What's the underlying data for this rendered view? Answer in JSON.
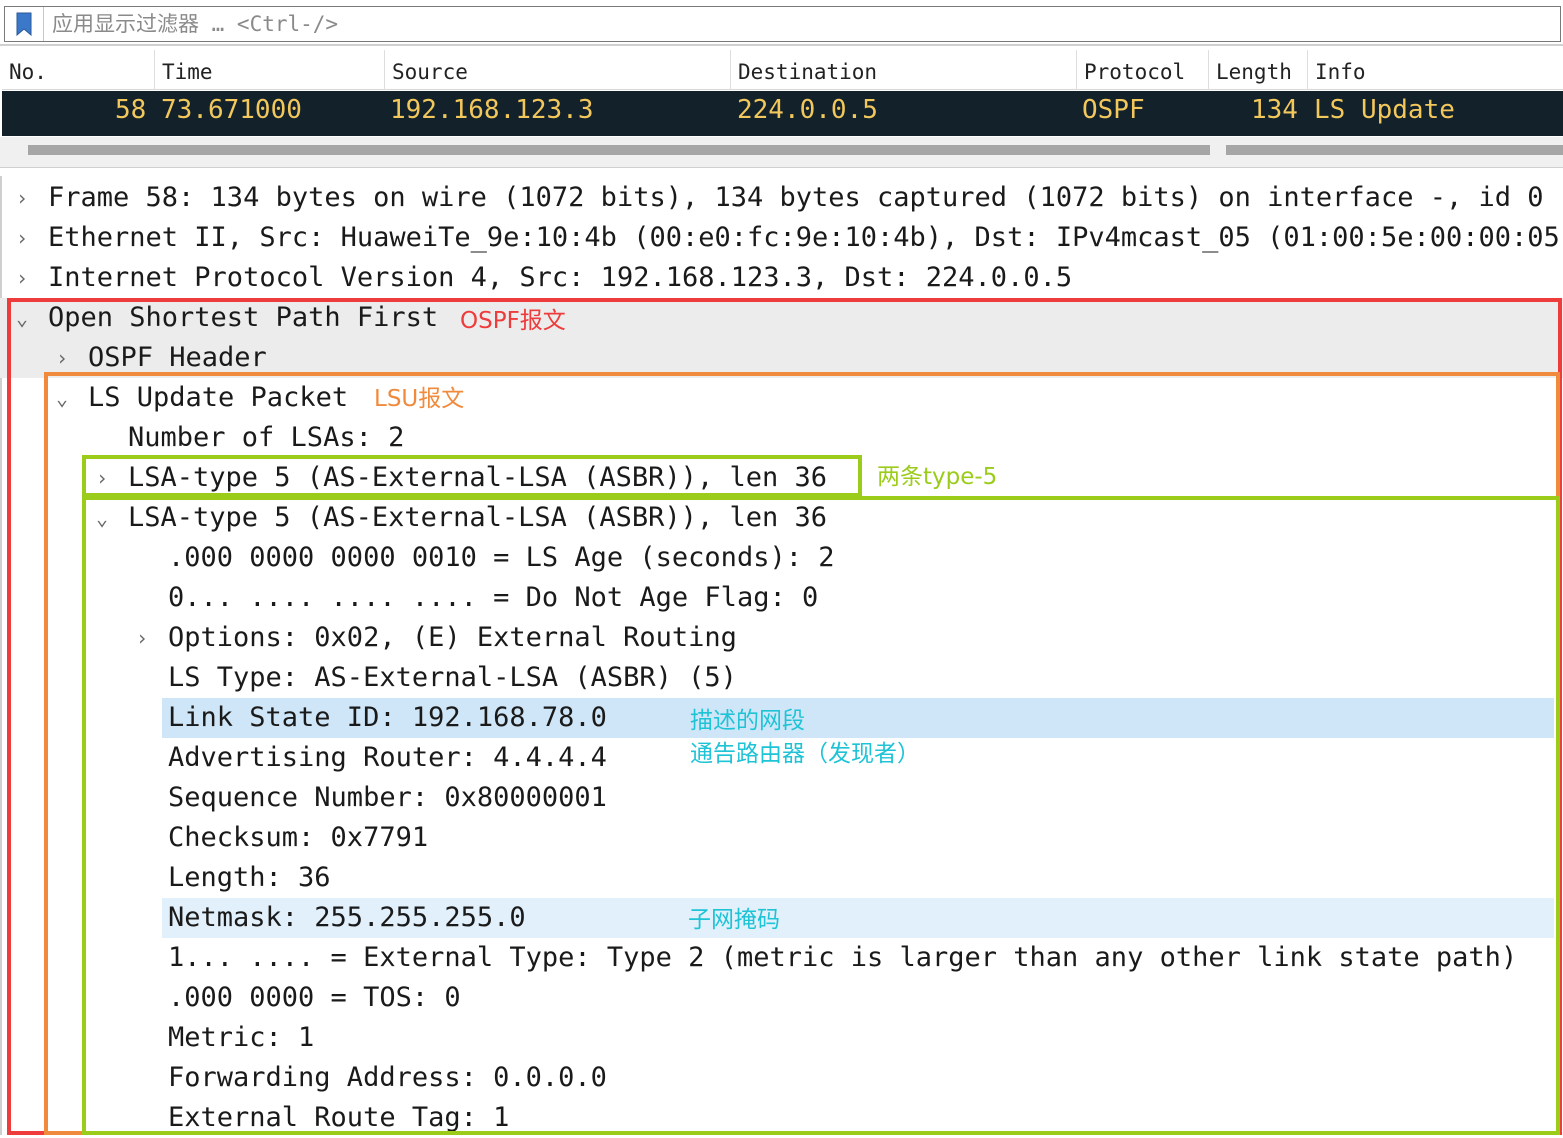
{
  "filter": {
    "placeholder": "应用显示过滤器 … <Ctrl-/>"
  },
  "packet_list": {
    "columns": [
      "No.",
      "Time",
      "Source",
      "Destination",
      "Protocol",
      "Length",
      "Info"
    ],
    "selected_row": {
      "no": "58",
      "time": "73.671000",
      "source": "192.168.123.3",
      "destination": "224.0.0.5",
      "protocol": "OSPF",
      "length": "134",
      "info": "LS Update"
    }
  },
  "details": {
    "frame": "Frame 58: 134 bytes on wire (1072 bits), 134 bytes captured (1072 bits) on interface -, id 0",
    "ethernet": "Ethernet II, Src: HuaweiTe_9e:10:4b (00:e0:fc:9e:10:4b), Dst: IPv4mcast_05 (01:00:5e:00:00:05)",
    "ip": "Internet Protocol Version 4, Src: 192.168.123.3, Dst: 224.0.0.5",
    "ospf": "Open Shortest Path First",
    "ospf_header": "OSPF Header",
    "ls_update": "LS Update Packet",
    "num_lsas": "Number of LSAs: 2",
    "lsa1": "LSA-type 5 (AS-External-LSA (ASBR)), len 36",
    "lsa2": "LSA-type 5 (AS-External-LSA (ASBR)), len 36",
    "fields": {
      "ls_age": ".000 0000 0000 0010 = LS Age (seconds): 2",
      "dna": "0... .... .... .... = Do Not Age Flag: 0",
      "options": "Options: 0x02, (E) External Routing",
      "ls_type": "LS Type: AS-External-LSA (ASBR) (5)",
      "link_state_id": "Link State ID: 192.168.78.0",
      "adv_router": "Advertising Router: 4.4.4.4",
      "seq": "Sequence Number: 0x80000001",
      "checksum": "Checksum: 0x7791",
      "length": "Length: 36",
      "netmask": "Netmask: 255.255.255.0",
      "ext_type": "1... .... = External Type: Type 2 (metric is larger than any other link state path)",
      "tos": ".000 0000 = TOS: 0",
      "metric": "Metric: 1",
      "fwd_addr": "Forwarding Address: 0.0.0.0",
      "route_tag": "External Route Tag: 1"
    }
  },
  "annotations": {
    "ospf": "OSPF报文",
    "lsu": "LSU报文",
    "two_type5": "两条type-5",
    "link_state_id": "描述的网段",
    "adv_router": "通告路由器（发现者）",
    "netmask": "子网掩码"
  },
  "colors": {
    "red": "#ee3b3b",
    "orange": "#f08a3c",
    "green": "#9bcc1a",
    "cyan": "#1fc3d6",
    "selected_row_bg": "#12212a",
    "selected_row_fg": "#f2c75c"
  },
  "icons": {
    "bookmark": "bookmark-icon",
    "collapsed": "chevron-right-icon",
    "expanded": "chevron-down-icon"
  }
}
